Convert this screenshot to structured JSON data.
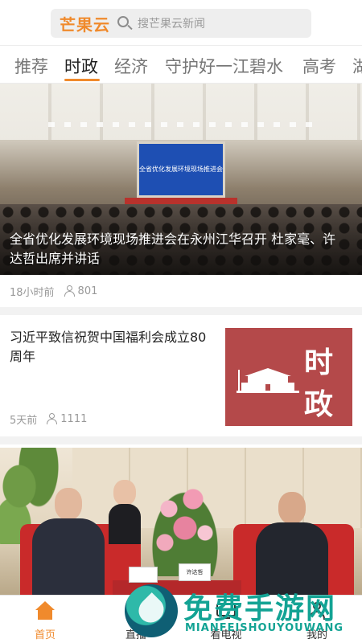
{
  "search": {
    "logo": "芒果云",
    "placeholder": "搜芒果云新闻",
    "search_icon": "search-icon"
  },
  "tabs": [
    {
      "label": "推荐",
      "active": false
    },
    {
      "label": "时政",
      "active": true
    },
    {
      "label": "经济",
      "active": false
    },
    {
      "label": "守护好一江碧水",
      "active": false
    },
    {
      "label": "高考",
      "active": false
    },
    {
      "label": "湖",
      "active": false
    }
  ],
  "feed": [
    {
      "title": "全省优化发展环境现场推进会在永州江华召开 杜家毫、许达哲出席并讲话",
      "banner_text": "全省优化发展环境现场推进会",
      "time": "18小时前",
      "views": "801",
      "views_icon": "user-icon"
    },
    {
      "title": "习近平致信祝贺中国福利会成立80周年",
      "thumb_char_1": "时",
      "thumb_char_2": "政",
      "time": "5天前",
      "views": "1111",
      "views_icon": "user-icon"
    },
    {
      "nameplate_right": "许达哲"
    }
  ],
  "bottom_nav": [
    {
      "label": "首页",
      "icon": "home-icon",
      "active": true
    },
    {
      "label": "直播",
      "icon": "live-icon",
      "active": false
    },
    {
      "label": "看电视",
      "icon": "tv-icon",
      "active": false
    },
    {
      "label": "我的",
      "icon": "user-icon",
      "active": false
    }
  ],
  "watermark": {
    "text": "免费手游网",
    "sub": "MIANFEISHOUYOUWANG"
  },
  "colors": {
    "accent": "#f08a2c",
    "thumb_bg": "#b4494a",
    "watermark": "#13a394"
  }
}
